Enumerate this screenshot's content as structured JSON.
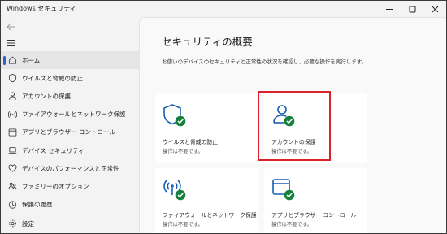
{
  "window": {
    "title": "Windows セキュリティ"
  },
  "sidebar": {
    "items": [
      {
        "label": "ホーム",
        "icon": "home-icon",
        "active": true
      },
      {
        "label": "ウイルスと脅威の防止",
        "icon": "shield-icon",
        "active": false
      },
      {
        "label": "アカウントの保護",
        "icon": "person-icon",
        "active": false
      },
      {
        "label": "ファイアウォールとネットワーク保護",
        "icon": "wifi-icon",
        "active": false
      },
      {
        "label": "アプリとブラウザー コントロール",
        "icon": "app-browser-icon",
        "active": false
      },
      {
        "label": "デバイス セキュリティ",
        "icon": "laptop-icon",
        "active": false
      },
      {
        "label": "デバイスのパフォーマンスと正常性",
        "icon": "heart-icon",
        "active": false
      },
      {
        "label": "ファミリーのオプション",
        "icon": "family-icon",
        "active": false
      },
      {
        "label": "保護の履歴",
        "icon": "history-icon",
        "active": false
      }
    ],
    "settings_label": "設定"
  },
  "main": {
    "title": "セキュリティの概要",
    "description": "お使いのデバイスのセキュリティと正常性の状況を確認し、必要な操作を実行します。"
  },
  "cards": [
    {
      "title": "ウイルスと脅威の防止",
      "status": "操作は不要です。",
      "icon": "shield-icon"
    },
    {
      "title": "アカウントの保護",
      "status": "操作は不要です。",
      "icon": "person-icon"
    },
    {
      "title": "ファイアウォールとネットワーク保護",
      "status": "操作は不要です。",
      "icon": "wifi-icon"
    },
    {
      "title": "アプリとブラウザー コントロール",
      "status": "操作は不要です。",
      "icon": "app-browser-icon"
    }
  ],
  "colors": {
    "accent": "#2a63c6",
    "icon_blue": "#1a5fb4",
    "check_green": "#16803c",
    "highlight_red": "#d8232a"
  }
}
